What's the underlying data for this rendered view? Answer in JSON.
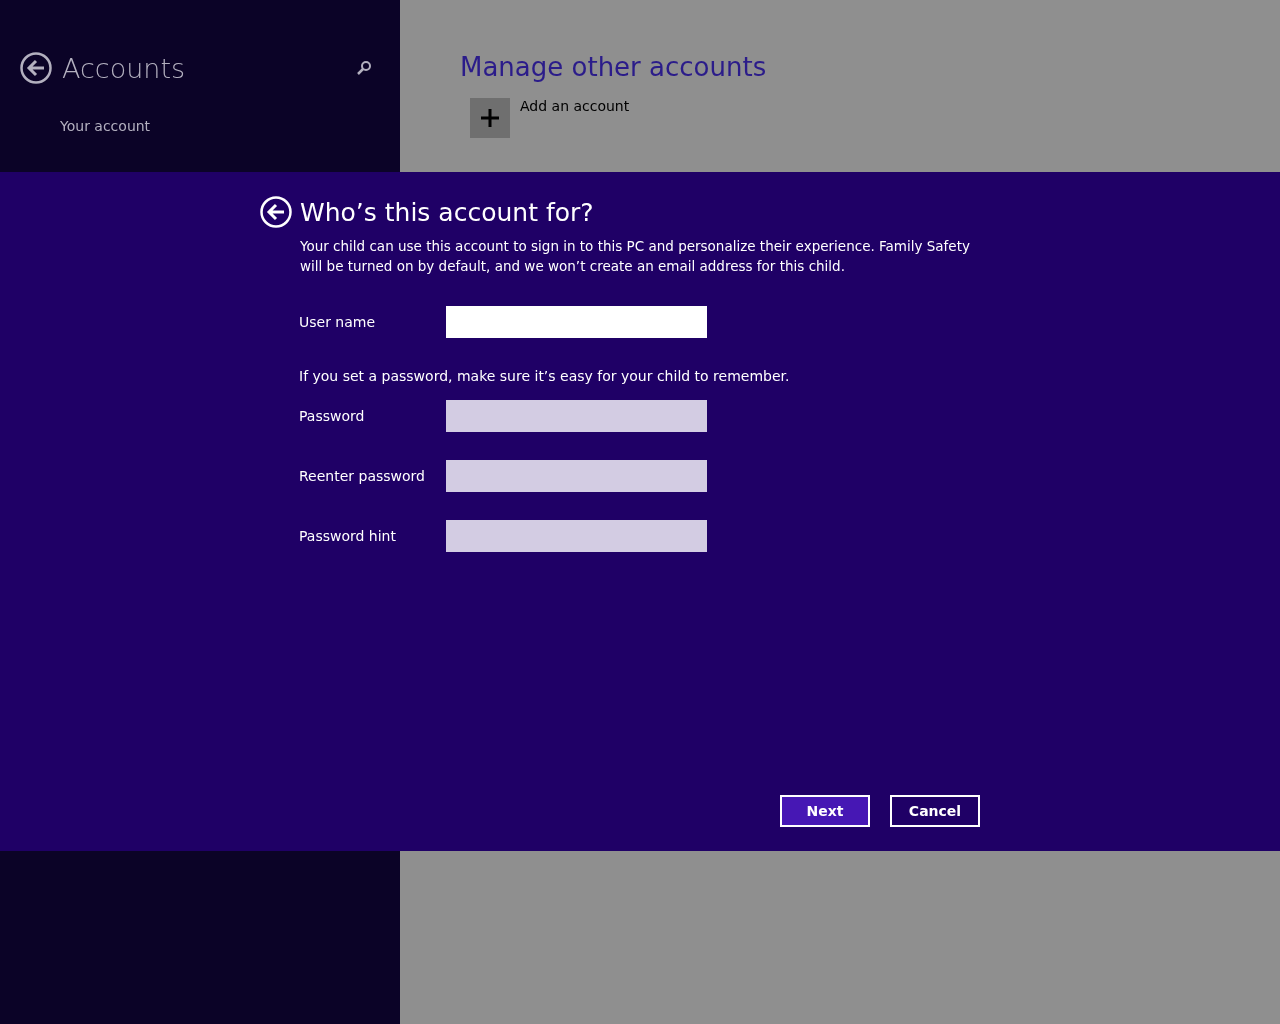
{
  "sidebar": {
    "title": "Accounts",
    "items": [
      {
        "label": "Your account",
        "selected": false
      }
    ]
  },
  "main": {
    "heading": "Manage other accounts",
    "add_label": "Add an account"
  },
  "dialog": {
    "title": "Who’s this account for?",
    "description": "Your child can use this account to sign in to this PC and personalize their experience. Family Safety will be turned on by default, and we won’t create an email address for this child.",
    "fields": [
      {
        "kind": "field",
        "label": "User name",
        "focused": true
      },
      {
        "kind": "note",
        "label": "If you set a password, make sure it’s easy for your child to remember."
      },
      {
        "kind": "field",
        "label": "Password",
        "focused": false
      },
      {
        "kind": "field",
        "label": "Reenter password",
        "focused": false
      },
      {
        "kind": "field",
        "label": "Password hint",
        "focused": false
      }
    ],
    "buttons": [
      {
        "label": "Next",
        "primary": true
      },
      {
        "label": "Cancel",
        "primary": false
      }
    ]
  }
}
